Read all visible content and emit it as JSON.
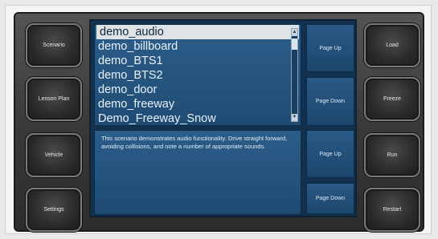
{
  "left_buttons": [
    {
      "label": "Scenario"
    },
    {
      "label": "Lesson Plan"
    },
    {
      "label": "Vehicle"
    },
    {
      "label": "Settings"
    }
  ],
  "right_buttons": [
    {
      "label": "Load"
    },
    {
      "label": "Freeze"
    },
    {
      "label": "Run"
    },
    {
      "label": "Restart"
    }
  ],
  "scenario_list": {
    "items": [
      "demo_audio",
      "demo_billboard",
      "demo_BTS1",
      "demo_BTS2",
      "demo_door",
      "demo_freeway",
      "Demo_Freeway_Snow"
    ],
    "selected_index": 0,
    "page_up_label": "Page Up",
    "page_down_label": "Page Down"
  },
  "description": {
    "text": "This scenario demonstrates audio functionality. Drive straight forward, avoiding collisions, and note a number of appropriate sounds.",
    "page_up_label": "Page Up",
    "page_down_label": "Page Down"
  },
  "colors": {
    "screen": "#12314e",
    "panel": "#1f4c74",
    "selection": "#dfe3e6"
  }
}
